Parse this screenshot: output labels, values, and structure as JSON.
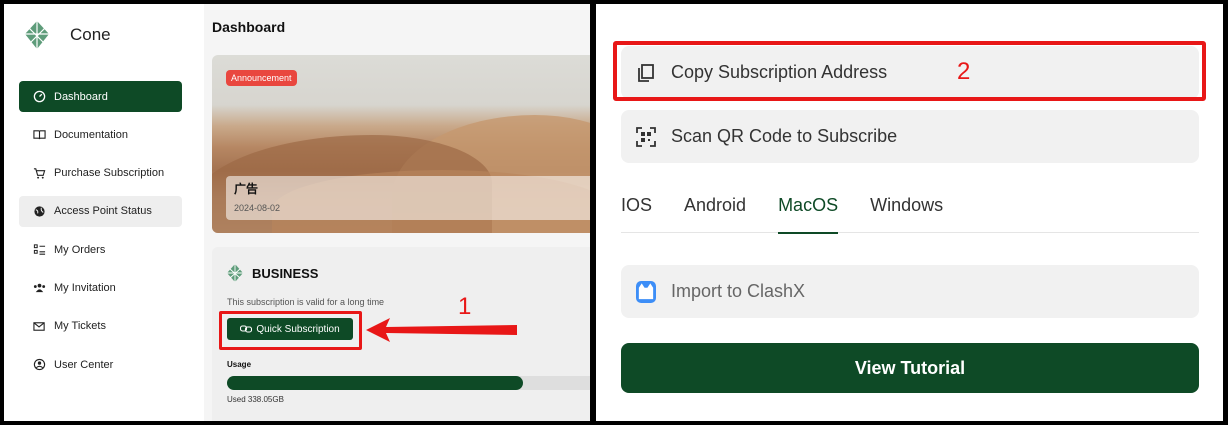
{
  "app": {
    "name": "Cone"
  },
  "sidebar": {
    "items": [
      {
        "label": "Dashboard",
        "icon": "dashboard-icon",
        "active": true
      },
      {
        "label": "Documentation",
        "icon": "book-icon"
      },
      {
        "label": "Purchase Subscription",
        "icon": "cart-icon"
      },
      {
        "label": "Access Point Status",
        "icon": "globe-icon"
      },
      {
        "label": "My Orders",
        "icon": "list-icon"
      },
      {
        "label": "My Invitation",
        "icon": "people-icon"
      },
      {
        "label": "My Tickets",
        "icon": "mail-icon"
      },
      {
        "label": "User Center",
        "icon": "user-circle-icon"
      }
    ]
  },
  "main": {
    "title": "Dashboard",
    "announcement": {
      "badge": "Announcement",
      "title": "广告",
      "date": "2024-08-02"
    },
    "subscription": {
      "plan": "BUSINESS",
      "description": "This subscription is valid for a long time",
      "quick_button": "Quick Subscription",
      "usage_label": "Usage",
      "usage_fraction": 0.8,
      "usage_text": "Used 338.05GB"
    }
  },
  "annotations": {
    "step1": "1",
    "step2": "2",
    "color": "#e81717"
  },
  "right": {
    "copy_label": "Copy Subscription Address",
    "scan_label": "Scan QR Code to Subscribe",
    "tabs": [
      {
        "label": "IOS"
      },
      {
        "label": "Android"
      },
      {
        "label": "MacOS",
        "active": true
      },
      {
        "label": "Windows"
      }
    ],
    "import_label": "Import to ClashX",
    "tutorial_label": "View Tutorial"
  },
  "colors": {
    "brand": "#0e4a26",
    "badge": "#e9473f"
  }
}
